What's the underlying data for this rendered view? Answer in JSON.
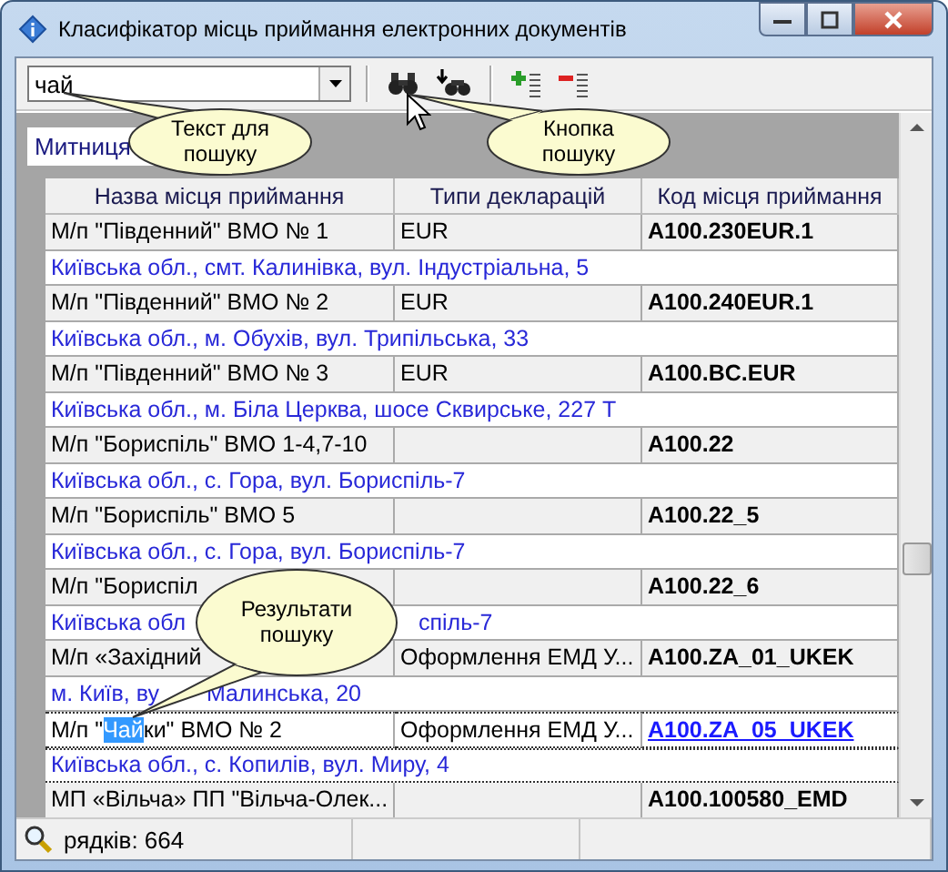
{
  "window": {
    "title": "Класифікатор місць приймання електронних документів"
  },
  "toolbar": {
    "search": {
      "value": "чай"
    }
  },
  "filter": {
    "label": "Митниця"
  },
  "table": {
    "columns": [
      "Назва місця приймання",
      "Типи декларацій",
      "Код місця приймання"
    ],
    "rows": [
      {
        "name": "М/п \"Південний\" ВМО № 1",
        "types": "EUR",
        "code": "A100.230EUR.1",
        "address": "Київська обл., смт. Калинівка, вул. Індустріальна, 5",
        "selected": false
      },
      {
        "name": "М/п \"Південний\" ВМО № 2",
        "types": "EUR",
        "code": "A100.240EUR.1",
        "address": "Київська обл., м. Обухів, вул. Трипільська, 33",
        "selected": false
      },
      {
        "name": "М/п \"Південний\" ВМО № 3",
        "types": "EUR",
        "code": "A100.BC.EUR",
        "address": "Київська обл., м. Біла Церква, шосе Сквирське, 227 Т",
        "selected": false
      },
      {
        "name": "М/п \"Бориспіль\" ВМО 1-4,7-10",
        "code": "A100.22",
        "address": "Київська обл., с. Гора, вул. Бориспіль-7",
        "selected": false
      },
      {
        "name": "М/п \"Бориспіль\" ВМО 5",
        "code": "A100.22_5",
        "address": "Київська обл., с. Гора, вул. Бориспіль-7",
        "selected": false
      },
      {
        "name": "М/п \"Бориспіл",
        "code": "A100.22_6",
        "address": "Київська обл",
        "address_after": "спіль-7",
        "selected": false
      },
      {
        "name": "М/п «Західний",
        "types": "Оформлення ЕМД У...",
        "code": "A100.ZA_01_UKEK",
        "address": "м. Київ, ву",
        "address_after": "Малинська, 20",
        "selected": false
      },
      {
        "name_parts": [
          {
            "text": "М/п \"",
            "highlight": false
          },
          {
            "text": "Чай",
            "highlight": true
          },
          {
            "text": "ки\" ВМО № 2",
            "highlight": false
          }
        ],
        "types": "Оформлення ЕМД У...",
        "code": "A100.ZA_05_UKEK",
        "address": "Київська обл., с. Копилів, вул. Миру, 4",
        "selected": true
      },
      {
        "name": "МП «Вільча» ПП \"Вільча-Олек...",
        "code": "A100.100580_EMD",
        "selected": false
      }
    ]
  },
  "callouts": [
    {
      "text": "Текст для пошуку"
    },
    {
      "text": "Кнопка пошуку"
    },
    {
      "text": "Результати пошуку"
    }
  ],
  "status_bar": {
    "rows": "рядків: 664"
  }
}
